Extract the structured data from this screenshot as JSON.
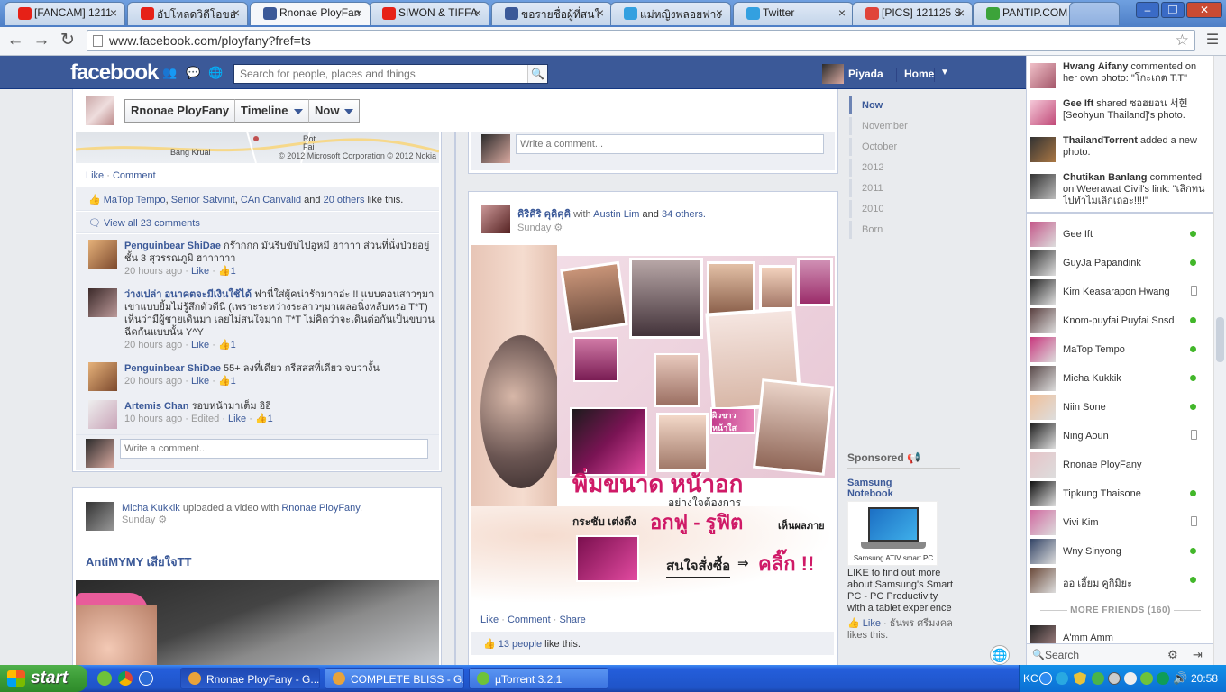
{
  "browser": {
    "tabs": [
      {
        "label": "[FANCAM] 1211",
        "icon": "youtube-icon",
        "color": "#e62117"
      },
      {
        "label": "อัปโหลดวิดีโอขอ",
        "icon": "youtube-icon",
        "color": "#e62117"
      },
      {
        "label": "Rnonae PloyFan",
        "icon": "facebook-icon",
        "color": "#3b5998",
        "active": true
      },
      {
        "label": "SIWON & TIFFA",
        "icon": "youtube-icon",
        "color": "#e62117"
      },
      {
        "label": "ขอรายชื่อผู้ที่สนใ",
        "icon": "facebook-icon",
        "color": "#3b5998"
      },
      {
        "label": "แม่หญิงพลอยฟาง",
        "icon": "twitter-icon",
        "color": "#33a0e0"
      },
      {
        "label": "Twitter",
        "icon": "twitter-icon",
        "color": "#33a0e0"
      },
      {
        "label": "[PICS] 121125 S",
        "icon": "ssfc-icon",
        "color": "#e0443a"
      },
      {
        "label": "PANTIP.COM : C",
        "icon": "pantip-icon",
        "color": "#3ca33a"
      }
    ],
    "url": "www.facebook.com/ployfany?fref=ts"
  },
  "fb": {
    "logo": "facebook",
    "search_placeholder": "Search for people, places and things",
    "user_name": "Piyada",
    "home": "Home"
  },
  "scrubber": {
    "name": "Rnonae PloyFany",
    "timeline": "Timeline",
    "now": "Now"
  },
  "left_post": {
    "map_label": "Bang Kruai",
    "map_label2": "Rot\nFai",
    "map_copyright": "© 2012 Microsoft Corporation © 2012 Nokia",
    "actions": {
      "like": "Like",
      "comment": "Comment"
    },
    "likes_names": [
      "MaTop Tempo",
      "Senior Satvinit",
      "CAn Canvalid"
    ],
    "likes_others": "20 others",
    "likes_suffix": "like this.",
    "and": "and",
    "view_all": "View all 23 comments",
    "comments": [
      {
        "name": "Penguinbear ShiDae",
        "text": "กร๊ากกก มันรีบขับไปอูหมี ฮาาาา ส่วนที่นั่งป่วยอยู่ชั้น 3 สุวรรณภูมิ ฮาาาาาา",
        "time": "20 hours ago",
        "like": "Like",
        "count": "1"
      },
      {
        "name": "ว่างเปล่า อนาคตจะมีเงินใช้ได้",
        "text": "ฟานี่ใส่ผู้คน่ารักมากอ่ะ !! แบบตอนสาวๆมา เขาแบบยิ้มไม่รู้สึกตัวดีนี่ (เพราะระหว่างระสาวๆมาเผลอนิ่งหลับหรอ T*T) เห็นว่ามีผู้ชายเดินมา เลยไม่สนใจมาก T*T ไม่คิดว่าจะเดินต่อกันเป็นขบวนฉีดกันแบบนั้น Y^Y",
        "time": "20 hours ago",
        "like": "Like",
        "count": "1"
      },
      {
        "name": "Penguinbear ShiDae",
        "text": "55+ ลงที่เดียว กรีสสสที่เดียว จบว่างั้น",
        "time": "20 hours ago",
        "like": "Like",
        "count": "1"
      },
      {
        "name": "Artemis Chan",
        "text": "รอบหน้ามาเต็ม อิอิ",
        "time": "10 hours ago",
        "edited": "Edited",
        "like": "Like",
        "count": "1"
      }
    ],
    "write_comment": "Write a comment..."
  },
  "video_post": {
    "author": "Micha Kukkik",
    "mid": "uploaded a video with",
    "with": "Rnonae PloyFany",
    "period": ".",
    "when": "Sunday",
    "title": "AntiMYMY เสียใจTT"
  },
  "right_post_top": {
    "write_comment": "Write a comment..."
  },
  "right_post": {
    "author": "คิริคิริ คุคิคุคิ",
    "with_word": "with",
    "with_name": "Austin Lim",
    "and_word": "and",
    "others": "34 others.",
    "when": "Sunday",
    "ad_headline": "พิ่มขนาด หน้าอก",
    "ad_line1": "อย่างใจต้องการ",
    "ad_line2": "กระชับ เต่งตึง",
    "ad_line3": "อกฟู - รูฟิต",
    "ad_line4": "เห็นผลภาย",
    "ad_cta": "สนใจสั่งซื้อ",
    "ad_click": "คลิ๊ก !!",
    "product_label": "ผิวขาว หน้าใส",
    "actions": {
      "like": "Like",
      "comment": "Comment",
      "share": "Share"
    },
    "likes": "13 people",
    "likes_suffix": "like this."
  },
  "timeline_nav": [
    "Now",
    "November",
    "October",
    "2012",
    "2011",
    "2010",
    "Born"
  ],
  "sponsored": {
    "title": "Sponsored",
    "ad_title": "Samsung Notebook",
    "ad_img_text": "Samsung ATIV smart PC",
    "ad_body": "LIKE to find out more about Samsung's Smart PC - PC Productivity with a tablet experience",
    "like": "Like",
    "liker": "ธันพร ศรีมงคล",
    "likes_suffix": "likes this."
  },
  "ticker": [
    {
      "name": "Hwang Aifany",
      "text": "commented on her own photo: \"โกะเกต T.T\""
    },
    {
      "name": "Gee Ift",
      "text": "shared ซอฮยอน 서현 [Seohyun Thailand]'s photo."
    },
    {
      "name": "ThailandTorrent",
      "text": "added a new photo."
    },
    {
      "name": "Chutikan Banlang",
      "text": "commented on Weerawat Civil's link: \"เลิกทนไปทำไมเลิกเถอะ!!!!\""
    }
  ],
  "chat": [
    {
      "name": "Gee Ift",
      "status": "online"
    },
    {
      "name": "GuyJa Papandink",
      "status": "online"
    },
    {
      "name": "Kim Keasarapon Hwang",
      "status": "mobile"
    },
    {
      "name": "Knom-puyfai Puyfai Snsd",
      "status": "online"
    },
    {
      "name": "MaTop Tempo",
      "status": "online"
    },
    {
      "name": "Micha Kukkik",
      "status": "online"
    },
    {
      "name": "Niin Sone",
      "status": "online"
    },
    {
      "name": "Ning Aoun",
      "status": "mobile"
    },
    {
      "name": "Rnonae PloyFany",
      "status": "none"
    },
    {
      "name": "Tipkung Thaisone",
      "status": "online"
    },
    {
      "name": "Vivi Kim",
      "status": "mobile"
    },
    {
      "name": "Wny Sinyong",
      "status": "online"
    },
    {
      "name": "ออ เอี้ยม คูกิมิยะ",
      "status": "online"
    }
  ],
  "more_friends": "MORE FRIENDS (160)",
  "last_friend": "A'mm Amm",
  "chat_search": "Search",
  "taskbar": {
    "start": "start",
    "tasks": [
      {
        "label": "Rnonae PloyFany - G...",
        "color": "#e8a33c",
        "active": true
      },
      {
        "label": "COMPLETE BLISS - G...",
        "color": "#e8a33c"
      },
      {
        "label": "µTorrent 3.2.1",
        "color": "#6ec23a"
      }
    ],
    "lang": "KC",
    "clock": "20:58"
  }
}
